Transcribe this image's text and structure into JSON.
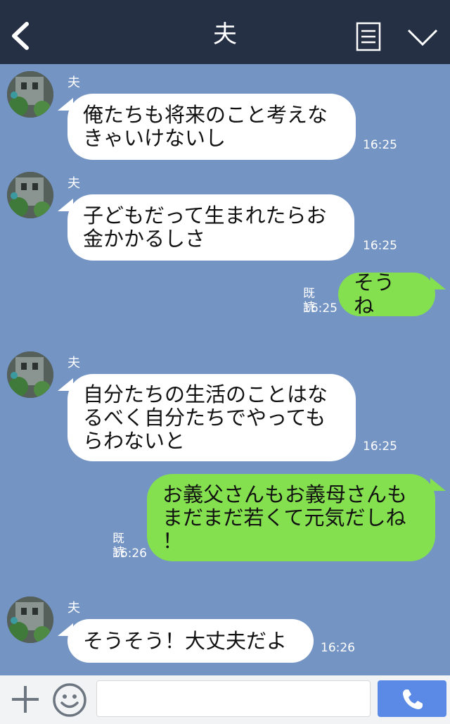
{
  "header": {
    "title": "夫",
    "back_icon": "back-chevron-icon",
    "menu_icon": "list-icon",
    "collapse_icon": "chevron-down-icon",
    "bg_color": "#263045"
  },
  "chat": {
    "bg_color": "#7494c4",
    "messages": [
      {
        "side": "in",
        "sender": "夫",
        "text": "俺たちも将来のこと考えな\nきゃいけないし",
        "time": "16:25"
      },
      {
        "side": "in",
        "sender": "夫",
        "text": "子どもだって生まれたらお\n金かかるしさ",
        "time": "16:25"
      },
      {
        "side": "out",
        "text": "そうね",
        "read": "既読",
        "time": "16:25"
      },
      {
        "side": "in",
        "sender": "夫",
        "text": "自分たちの生活のことはな\nるべく自分たちでやっても\nらわないと",
        "time": "16:25"
      },
      {
        "side": "out",
        "text": "お義父さんもお義母さんも\nまだまだ若くて元気だしね\n！",
        "read": "既読",
        "time": "16:26"
      },
      {
        "side": "in",
        "sender": "夫",
        "text": "そうそう！大丈夫だよ",
        "time": "16:26"
      }
    ]
  },
  "footer": {
    "plus_icon": "plus-icon",
    "emoji_icon": "smile-icon",
    "input_value": "",
    "call_icon": "phone-icon",
    "call_color": "#5b8ae6"
  },
  "colors": {
    "incoming_bubble": "#ffffff",
    "outgoing_bubble": "#84e04f"
  }
}
